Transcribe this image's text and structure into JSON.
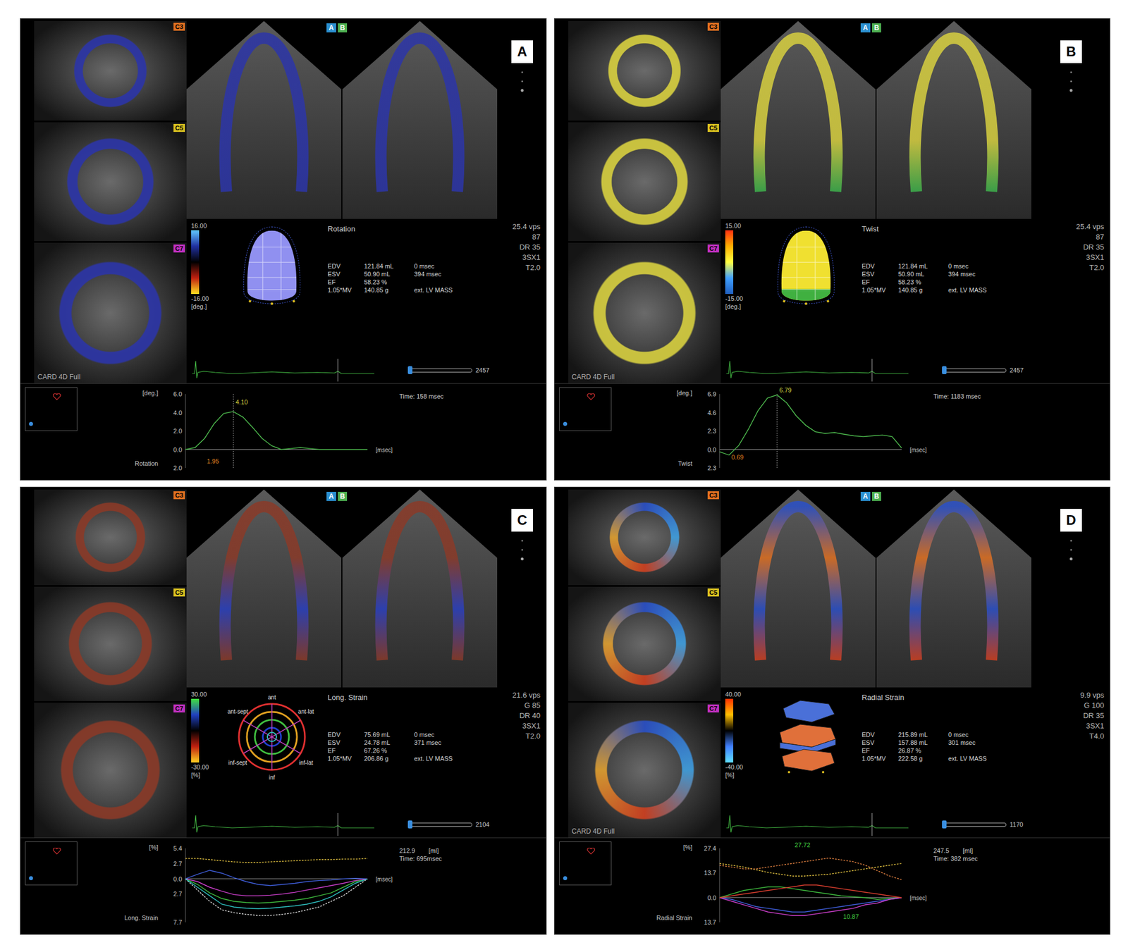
{
  "panels": [
    {
      "letter": "A",
      "tags": [
        {
          "label": "A",
          "color": "#2a8fd0"
        },
        {
          "label": "B",
          "color": "#4caf50"
        }
      ],
      "short_axis": [
        {
          "label": "C3",
          "color": "#e07020"
        },
        {
          "label": "C5",
          "color": "#d8c020"
        },
        {
          "label": "C7",
          "color": "#c030c0"
        }
      ],
      "ring_colors": [
        "#2c35a8"
      ],
      "apical_colors": [
        "#2c35a8",
        "#2c35a8"
      ],
      "card_label": "CARD 4D Full",
      "side_text": [
        "25.4 vps",
        "87",
        "DR 35",
        "3SX1",
        "T2.0"
      ],
      "colorbar": {
        "max": "16.00",
        "min": "-16.00",
        "unit": "[deg.]",
        "colors": [
          "#60c8ff",
          "#2030a0",
          "#000000",
          "#c02010",
          "#ffe020"
        ]
      },
      "model": {
        "kind": "mesh",
        "colors": [
          "#9090f0"
        ]
      },
      "title": "Rotation",
      "stats": [
        [
          "EDV",
          "121.84 mL",
          "0 msec"
        ],
        [
          "ESV",
          "50.90 mL",
          "394 msec"
        ],
        [
          "EF",
          "58.23 %"
        ],
        [
          "1.05*MV",
          "140.85 g",
          "ext. LV MASS"
        ]
      ],
      "slider": {
        "value": "2457",
        "level": 0.02
      },
      "chart": {
        "unit": "[deg.]",
        "axis_label": "Rotation",
        "ticks": [
          "6.0",
          "4.0",
          "2.0",
          "0.0",
          "2.0"
        ],
        "time": "Time: 158 msec",
        "x_unit": "[msec]",
        "cursor": 5,
        "series": [
          {
            "color": "#50c050",
            "dashed": false,
            "values": [
              0,
              0.2,
              1.2,
              2.8,
              3.9,
              4.1,
              3.5,
              2.4,
              1.2,
              0.4,
              0.0,
              0.1,
              0.2,
              0.1,
              0.0,
              0.0,
              0.0,
              0.0,
              0.0,
              0.0
            ]
          }
        ],
        "annotations": [
          {
            "text": "4.10",
            "index": 5,
            "value": 4.8,
            "color": "#d8d840"
          },
          {
            "text": "1.95",
            "index": 2,
            "value": -1.6,
            "color": "#e08020"
          }
        ]
      }
    },
    {
      "letter": "B",
      "tags": [
        {
          "label": "A",
          "color": "#2a8fd0"
        },
        {
          "label": "B",
          "color": "#4caf50"
        }
      ],
      "short_axis": [
        {
          "label": "C3",
          "color": "#e07020"
        },
        {
          "label": "C5",
          "color": "#d8c020"
        },
        {
          "label": "C7",
          "color": "#c030c0"
        }
      ],
      "ring_colors": [
        "#d8d040"
      ],
      "apical_colors": [
        "#d8d040",
        "#d8d040",
        "#d8d040",
        "#3cb04c"
      ],
      "card_label": "CARD 4D Full",
      "side_text": [
        "25.4 vps",
        "87",
        "DR 35",
        "3SX1",
        "T2.0"
      ],
      "colorbar": {
        "max": "15.00",
        "min": "-15.00",
        "unit": "[deg.]",
        "colors": [
          "#ff3010",
          "#ffb000",
          "#ffff40",
          "#40a0ff",
          "#2060c0"
        ]
      },
      "model": {
        "kind": "mesh",
        "colors": [
          "#f0e030",
          "#40b040"
        ]
      },
      "title": "Twist",
      "stats": [
        [
          "EDV",
          "121.84 mL",
          "0 msec"
        ],
        [
          "ESV",
          "50.90 mL",
          "394 msec"
        ],
        [
          "EF",
          "58.23 %"
        ],
        [
          "1.05*MV",
          "140.85 g",
          "ext. LV MASS"
        ]
      ],
      "slider": {
        "value": "2457",
        "level": 0.02
      },
      "chart": {
        "unit": "[deg.]",
        "axis_label": "Twist",
        "ticks": [
          "6.9",
          "4.6",
          "2.3",
          "0.0",
          "2.3"
        ],
        "time": "Time: 1183 msec",
        "x_unit": "[msec]",
        "cursor": 6,
        "series": [
          {
            "color": "#50c050",
            "dashed": false,
            "values": [
              -0.3,
              -0.69,
              0.5,
              2.5,
              4.8,
              6.4,
              6.79,
              5.8,
              4.2,
              3.0,
              2.2,
              2.0,
              2.1,
              1.9,
              1.7,
              1.6,
              1.7,
              1.8,
              1.6,
              0.2
            ]
          }
        ],
        "annotations": [
          {
            "text": "6.79",
            "index": 6,
            "value": 7.0,
            "color": "#d8d840"
          },
          {
            "text": "0.69",
            "index": 1,
            "value": -1.4,
            "color": "#e08020"
          }
        ]
      }
    },
    {
      "letter": "C",
      "tags": [
        {
          "label": "A",
          "color": "#2a8fd0"
        },
        {
          "label": "B",
          "color": "#4caf50"
        }
      ],
      "short_axis": [
        {
          "label": "C3",
          "color": "#e07020"
        },
        {
          "label": "C5",
          "color": "#d8c020"
        },
        {
          "label": "C7",
          "color": "#c030c0"
        }
      ],
      "ring_colors": [
        "#8a3a28"
      ],
      "apical_colors": [
        "#8a3a28",
        "#8a3a28",
        "#2a40c0",
        "#8a3a28"
      ],
      "side_text": [
        "21.6 vps",
        "G 85",
        "DR 40",
        "3SX1",
        "T2.0"
      ],
      "colorbar": {
        "max": "30.00",
        "min": "-30.00",
        "unit": "[%]",
        "colors": [
          "#40e040",
          "#2040c0",
          "#000000",
          "#c02010",
          "#ffd020"
        ]
      },
      "model": {
        "kind": "bullseye",
        "colors": [
          "#e03030",
          "#e0a020",
          "#40c040",
          "#2040d0",
          "#c040c0",
          "#30c0c0"
        ],
        "labels": [
          "ant",
          "ant-sept",
          "ant-lat",
          "inf-sept",
          "inf-lat",
          "inf"
        ]
      },
      "title": "Long. Strain",
      "stats": [
        [
          "EDV",
          "75.69 mL",
          "0 msec"
        ],
        [
          "ESV",
          "24.78 mL",
          "371 msec"
        ],
        [
          "EF",
          "67.26 %"
        ],
        [
          "1.05*MV",
          "206.86 g",
          "ext. LV MASS"
        ]
      ],
      "slider": {
        "value": "2104",
        "level": 0.02
      },
      "chart": {
        "unit": "[%]",
        "axis_label": "Long. Strain",
        "ticks": [
          "5.4",
          "2.7",
          "0.0",
          "2.7",
          "7.7"
        ],
        "time": "Time: 695msec",
        "x_unit": "[msec]",
        "right_value": "212.9",
        "right_unit": "[ml]",
        "series": [
          {
            "color": "#e0c040",
            "dashed": true,
            "values": [
              3.6,
              3.6,
              3.4,
              3.2,
              3.0,
              2.9,
              2.9,
              3.0,
              3.1,
              3.2,
              3.3,
              3.4,
              3.4,
              3.5,
              3.5,
              3.6
            ]
          },
          {
            "color": "#e0e0e0",
            "dashed": true,
            "values": [
              0,
              -2,
              -4,
              -5.5,
              -6,
              -6.3,
              -6.5,
              -6.5,
              -6.3,
              -6,
              -5.5,
              -5,
              -4,
              -3,
              -1.5,
              0
            ]
          },
          {
            "color": "#40c040",
            "dashed": false,
            "values": [
              0,
              -1,
              -2.5,
              -3.5,
              -4,
              -4.2,
              -4.3,
              -4.2,
              -4,
              -3.8,
              -3.5,
              -3,
              -2.5,
              -1.5,
              -0.5,
              0
            ]
          },
          {
            "color": "#4060e0",
            "dashed": false,
            "values": [
              0,
              0.8,
              1.5,
              1,
              0.2,
              -0.5,
              -1,
              -1.2,
              -1,
              -0.8,
              -0.5,
              -0.3,
              -0.2,
              0,
              0.1,
              0
            ]
          },
          {
            "color": "#d040d0",
            "dashed": false,
            "values": [
              0,
              -0.5,
              -1.5,
              -2.2,
              -2.8,
              -3,
              -3,
              -2.9,
              -2.7,
              -2.4,
              -2,
              -1.6,
              -1.2,
              -0.8,
              -0.3,
              0
            ]
          },
          {
            "color": "#30c8c8",
            "dashed": false,
            "values": [
              0,
              -1.5,
              -3,
              -4.5,
              -5,
              -5.2,
              -5.3,
              -5.2,
              -5,
              -4.8,
              -4.5,
              -4,
              -3.2,
              -2,
              -0.8,
              0
            ]
          }
        ],
        "annotations": []
      }
    },
    {
      "letter": "D",
      "tags": [
        {
          "label": "A",
          "color": "#2a8fd0"
        },
        {
          "label": "B",
          "color": "#4caf50"
        }
      ],
      "short_axis": [
        {
          "label": "C3",
          "color": "#e07020"
        },
        {
          "label": "C5",
          "color": "#d8c020"
        },
        {
          "label": "C7",
          "color": "#c030c0"
        }
      ],
      "ring_colors": [
        "#2a50c8",
        "#40a0e0",
        "#d04020",
        "#e0a030"
      ],
      "apical_colors": [
        "#2a50c8",
        "#e07020",
        "#2a50c8",
        "#d04020"
      ],
      "card_label": "CARD 4D Full",
      "side_text": [
        "9.9 vps",
        "G 100",
        "DR 35",
        "3SX1",
        "T4.0"
      ],
      "colorbar": {
        "max": "40.00",
        "min": "-40.00",
        "unit": "[%]",
        "colors": [
          "#ff3000",
          "#ffc000",
          "#000000",
          "#4080ff",
          "#60e0ff"
        ]
      },
      "model": {
        "kind": "slabs",
        "colors": [
          "#4a70d8",
          "#e0703a",
          "#e0703a"
        ]
      },
      "title": "Radial Strain",
      "stats": [
        [
          "EDV",
          "215.89 mL",
          "0 msec"
        ],
        [
          "ESV",
          "157.88 mL",
          "301 msec"
        ],
        [
          "EF",
          "26.87 %"
        ],
        [
          "1.05*MV",
          "222.58 g",
          "ext. LV MASS"
        ]
      ],
      "slider": {
        "value": "1170",
        "level": 0.02
      },
      "chart": {
        "unit": "[%]",
        "axis_label": "Radial Strain",
        "ticks": [
          "27.4",
          "13.7",
          "0.0",
          "13.7"
        ],
        "time": "Time: 382 msec",
        "x_unit": "[msec]",
        "right_value": "247.5",
        "right_unit": "[ml]",
        "series": [
          {
            "color": "#e0c040",
            "dashed": true,
            "values": [
              19,
              18,
              17,
              15.5,
              14,
              13,
              12,
              12,
              12.5,
              13,
              14,
              15,
              16,
              17,
              18,
              19
            ]
          },
          {
            "color": "#e08040",
            "dashed": true,
            "values": [
              18,
              17,
              16,
              16,
              17,
              18,
              19,
              20,
              21,
              22,
              21,
              20,
              18,
              15,
              12,
              10
            ]
          },
          {
            "color": "#40c040",
            "dashed": false,
            "values": [
              0,
              2,
              4,
              5,
              6,
              6,
              5,
              4,
              3,
              2,
              1,
              0.5,
              0,
              -1,
              -0.5,
              0
            ]
          },
          {
            "color": "#4060e0",
            "dashed": false,
            "values": [
              0,
              -1,
              -3,
              -5,
              -6,
              -7,
              -8,
              -8,
              -7,
              -6,
              -5,
              -4,
              -3,
              -2,
              -1,
              0
            ]
          },
          {
            "color": "#d040d0",
            "dashed": false,
            "values": [
              0,
              -2,
              -4,
              -6,
              -8,
              -9,
              -10,
              -10,
              -9,
              -8,
              -7,
              -6,
              -4,
              -3,
              -1,
              0
            ]
          },
          {
            "color": "#e04030",
            "dashed": false,
            "values": [
              0,
              1,
              2,
              3,
              4,
              5,
              6,
              7,
              7,
              6,
              5,
              4,
              3,
              2,
              1,
              0
            ]
          }
        ],
        "annotations": [
          {
            "text": "27.72",
            "index": 6,
            "value": 27.4,
            "color": "#40d040"
          },
          {
            "text": "10.87",
            "index": 10,
            "value": -12.5,
            "color": "#40d040"
          }
        ]
      }
    }
  ]
}
